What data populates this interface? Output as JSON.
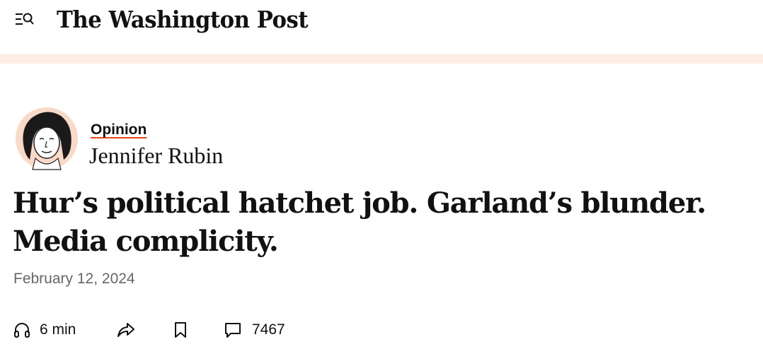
{
  "header": {
    "menu_icon": "menu-search-icon",
    "logo": "The Washington Post"
  },
  "article": {
    "section": "Opinion",
    "author": "Jennifer Rubin",
    "headline": "Hur’s political hatchet job. Garland’s blunder. Media complicity.",
    "date": "February 12, 2024"
  },
  "actions": {
    "listen_label": "6 min",
    "listen_icon": "headphones-icon",
    "share_icon": "share-icon",
    "save_icon": "bookmark-icon",
    "comments_icon": "comment-icon",
    "comments_count": "7467"
  },
  "colors": {
    "band": "#fdeee3",
    "accent": "#e8451c",
    "date": "#666666"
  }
}
